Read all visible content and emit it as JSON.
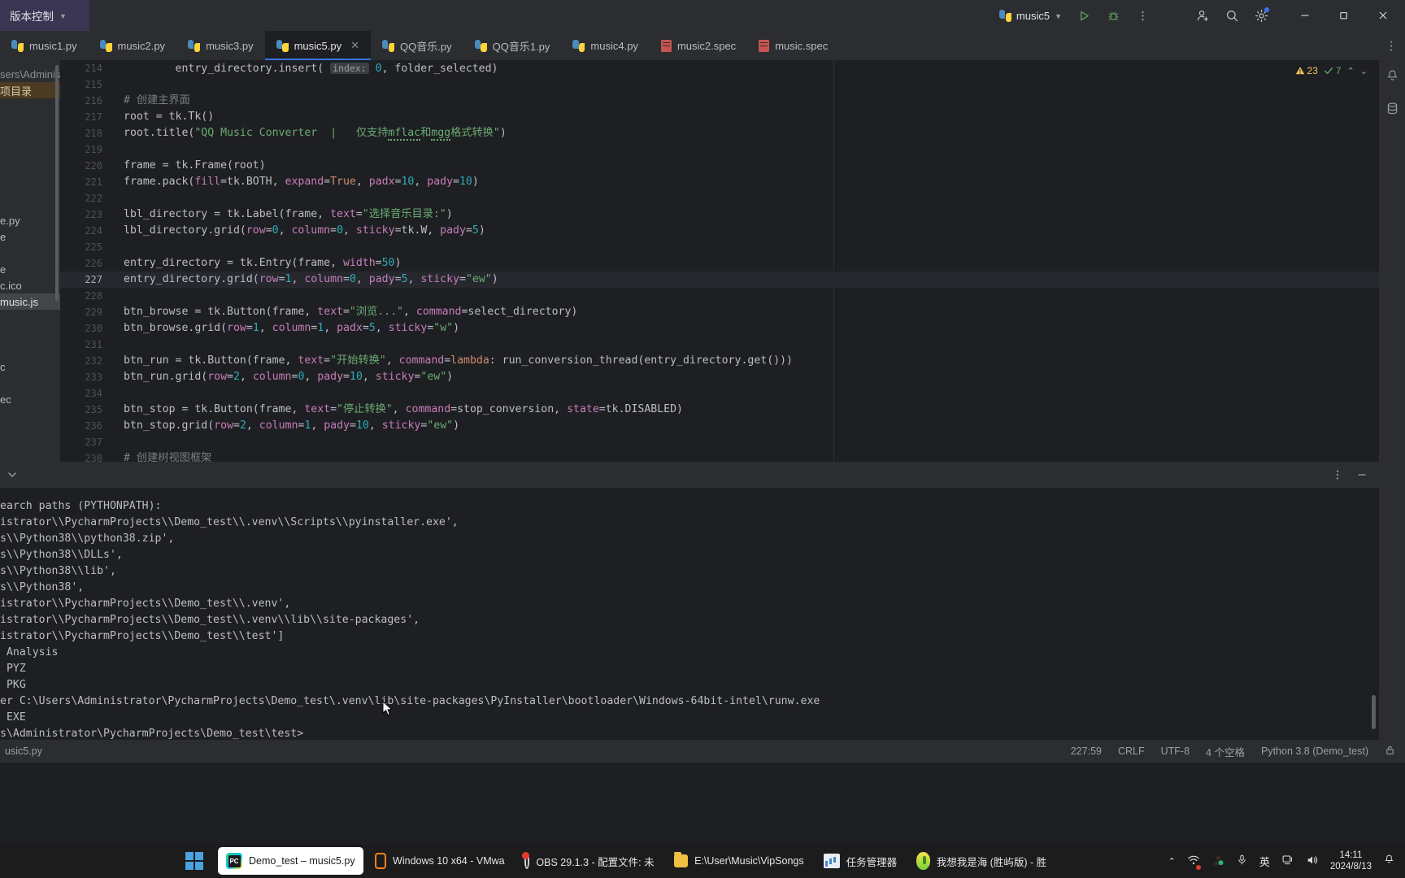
{
  "titlebar": {
    "vcs_label": "版本控制",
    "run_config": "music5",
    "icons": {
      "run": "run-icon",
      "debug": "debug-icon",
      "more": "more-options-icon",
      "add_user": "add-user-icon",
      "search": "search-icon",
      "settings": "settings-icon",
      "minimize": "minimize-icon",
      "maximize": "restore-icon",
      "close": "close-icon"
    }
  },
  "tabs": [
    {
      "label": "music1.py",
      "icon": "python-file-icon",
      "active": false,
      "closable": false
    },
    {
      "label": "music2.py",
      "icon": "python-file-icon",
      "active": false,
      "closable": false
    },
    {
      "label": "music3.py",
      "icon": "python-file-icon",
      "active": false,
      "closable": false
    },
    {
      "label": "music5.py",
      "icon": "python-file-icon",
      "active": true,
      "closable": true
    },
    {
      "label": "QQ音乐.py",
      "icon": "python-file-icon",
      "active": false,
      "closable": false
    },
    {
      "label": "QQ音乐1.py",
      "icon": "python-file-icon",
      "active": false,
      "closable": false
    },
    {
      "label": "music4.py",
      "icon": "python-file-icon",
      "active": false,
      "closable": false
    },
    {
      "label": "music2.spec",
      "icon": "spec-file-icon",
      "active": false,
      "closable": false
    },
    {
      "label": "music.spec",
      "icon": "spec-file-icon",
      "active": false,
      "closable": false
    }
  ],
  "project_panel": {
    "rows": [
      {
        "text": "sers\\Administrat",
        "style": "dimmed"
      },
      {
        "text": "项目录",
        "style": "sel-orange"
      },
      {
        "text": "",
        "style": "normal"
      },
      {
        "text": "",
        "style": "normal"
      },
      {
        "text": "",
        "style": "normal"
      },
      {
        "text": "",
        "style": "normal"
      },
      {
        "text": "",
        "style": "normal"
      },
      {
        "text": "",
        "style": "normal"
      },
      {
        "text": "",
        "style": "normal"
      },
      {
        "text": "e.py",
        "style": "normal"
      },
      {
        "text": "e",
        "style": "normal"
      },
      {
        "text": "",
        "style": "normal"
      },
      {
        "text": "e",
        "style": "normal"
      },
      {
        "text": "c.ico",
        "style": "normal"
      },
      {
        "text": "music.js",
        "style": "sel-grey"
      },
      {
        "text": "",
        "style": "normal"
      },
      {
        "text": "",
        "style": "normal"
      },
      {
        "text": "",
        "style": "normal"
      },
      {
        "text": "c",
        "style": "normal"
      },
      {
        "text": "",
        "style": "normal"
      },
      {
        "text": "ec",
        "style": "normal"
      }
    ]
  },
  "editor": {
    "inspections": {
      "warnings": "23",
      "ok": "7"
    },
    "first_line": 214,
    "current_line": 227,
    "lines": [
      {
        "n": 214,
        "html": "        <span class=\"fn\">entry_directory</span>.insert( <span class=\"hint\">index:</span> <span class=\"num\">0</span>, folder_selected)"
      },
      {
        "n": 215,
        "html": ""
      },
      {
        "n": 216,
        "html": "<span class=\"cmt\"># 创建主界面</span>"
      },
      {
        "n": 217,
        "html": "root = tk.Tk()"
      },
      {
        "n": 218,
        "html": "root.title(<span class=\"str\">\"QQ Music Converter  |   仅支持<span class=\"wavy\">mflac</span>和<span class=\"wavy\">mgg</span>格式转换\"</span>)"
      },
      {
        "n": 219,
        "html": ""
      },
      {
        "n": 220,
        "html": "frame = tk.Frame(root)"
      },
      {
        "n": 221,
        "html": "frame.pack(<span class=\"pname\">fill</span>=tk.BOTH, <span class=\"pname\">expand</span>=<span class=\"kw\">True</span>, <span class=\"pname\">padx</span>=<span class=\"num\">10</span>, <span class=\"pname\">pady</span>=<span class=\"num\">10</span>)"
      },
      {
        "n": 222,
        "html": ""
      },
      {
        "n": 223,
        "html": "lbl_directory = tk.Label(frame, <span class=\"pname\">text</span>=<span class=\"str\">\"选择音乐目录:\"</span>)"
      },
      {
        "n": 224,
        "html": "lbl_directory.grid(<span class=\"pname\">row</span>=<span class=\"num\">0</span>, <span class=\"pname\">column</span>=<span class=\"num\">0</span>, <span class=\"pname\">sticky</span>=tk.W, <span class=\"pname\">pady</span>=<span class=\"num\">5</span>)"
      },
      {
        "n": 225,
        "html": ""
      },
      {
        "n": 226,
        "html": "entry_directory = tk.Entry(frame, <span class=\"pname\">width</span>=<span class=\"num\">50</span>)"
      },
      {
        "n": 227,
        "html": "entry_directory.grid(<span class=\"pname\">row</span>=<span class=\"num\">1</span>, <span class=\"pname\">column</span>=<span class=\"num\">0</span>, <span class=\"pname\">pady</span>=<span class=\"num\">5</span>, <span class=\"pname\">sticky</span>=<span class=\"str\">\"ew\"</span>)"
      },
      {
        "n": 228,
        "html": ""
      },
      {
        "n": 229,
        "html": "btn_browse = tk.Button(frame, <span class=\"pname\">text</span>=<span class=\"str\">\"浏览...\"</span>, <span class=\"pname\">command</span>=select_directory)"
      },
      {
        "n": 230,
        "html": "btn_browse.grid(<span class=\"pname\">row</span>=<span class=\"num\">1</span>, <span class=\"pname\">column</span>=<span class=\"num\">1</span>, <span class=\"pname\">padx</span>=<span class=\"num\">5</span>, <span class=\"pname\">sticky</span>=<span class=\"str\">\"w\"</span>)"
      },
      {
        "n": 231,
        "html": ""
      },
      {
        "n": 232,
        "html": "btn_run = tk.Button(frame, <span class=\"pname\">text</span>=<span class=\"str\">\"开始转换\"</span>, <span class=\"pname\">command</span>=<span class=\"kw\">lambda</span>: run_conversion_thread(entry_directory.get()))"
      },
      {
        "n": 233,
        "html": "btn_run.grid(<span class=\"pname\">row</span>=<span class=\"num\">2</span>, <span class=\"pname\">column</span>=<span class=\"num\">0</span>, <span class=\"pname\">pady</span>=<span class=\"num\">10</span>, <span class=\"pname\">sticky</span>=<span class=\"str\">\"ew\"</span>)"
      },
      {
        "n": 234,
        "html": ""
      },
      {
        "n": 235,
        "html": "btn_stop = tk.Button(frame, <span class=\"pname\">text</span>=<span class=\"str\">\"停止转换\"</span>, <span class=\"pname\">command</span>=stop_conversion, <span class=\"pname\">state</span>=tk.DISABLED)"
      },
      {
        "n": 236,
        "html": "btn_stop.grid(<span class=\"pname\">row</span>=<span class=\"num\">2</span>, <span class=\"pname\">column</span>=<span class=\"num\">1</span>, <span class=\"pname\">pady</span>=<span class=\"num\">10</span>, <span class=\"pname\">sticky</span>=<span class=\"str\">\"ew\"</span>)"
      },
      {
        "n": 237,
        "html": ""
      },
      {
        "n": 238,
        "html": "<span class=\"cmt\"># 创建树视图框架</span>"
      }
    ]
  },
  "console": {
    "lines": [
      "earch paths (PYTHONPATH):",
      "istrator\\\\PycharmProjects\\\\Demo_test\\\\.venv\\\\Scripts\\\\pyinstaller.exe',",
      "s\\\\Python38\\\\python38.zip',",
      "s\\\\Python38\\\\DLLs',",
      "s\\\\Python38\\\\lib',",
      "s\\\\Python38',",
      "istrator\\\\PycharmProjects\\\\Demo_test\\\\.venv',",
      "istrator\\\\PycharmProjects\\\\Demo_test\\\\.venv\\\\lib\\\\site-packages',",
      "istrator\\\\PycharmProjects\\\\Demo_test\\\\test']",
      " Analysis",
      " PYZ",
      " PKG",
      "er C:\\Users\\Administrator\\PycharmProjects\\Demo_test\\.venv\\lib\\site-packages\\PyInstaller\\bootloader\\Windows-64bit-intel\\runw.exe",
      " EXE",
      "s\\Administrator\\PycharmProjects\\Demo_test\\test>"
    ]
  },
  "statusbar": {
    "file_label": "usic5.py",
    "caret": "227:59",
    "line_sep": "CRLF",
    "encoding": "UTF-8",
    "indent": "4 个空格",
    "interpreter": "Python 3.8 (Demo_test)",
    "lock_icon": "lock-icon"
  },
  "taskbar": {
    "items": [
      {
        "label": "Demo_test – music5.py",
        "icon": "pycharm-icon",
        "active": true
      },
      {
        "label": "Windows 10 x64 - VMwa",
        "icon": "vmware-icon",
        "active": false
      },
      {
        "label": "OBS 29.1.3 - 配置文件: 未",
        "icon": "obs-icon",
        "active": false
      },
      {
        "label": "E:\\User\\Music\\VipSongs",
        "icon": "folder-icon",
        "active": false
      },
      {
        "label": "任务管理器",
        "icon": "task-manager-icon",
        "active": false
      },
      {
        "label": "我想我是海 (胜屿版) - 胜",
        "icon": "music-player-icon",
        "active": false
      }
    ],
    "tray": {
      "overflow_icon": "chevron-up-icon",
      "network_icon": "network-icon",
      "security_icon": "security-icon",
      "mic_icon": "microphone-icon",
      "ime_label": "英",
      "display_icon": "display-icon",
      "volume_icon": "volume-icon",
      "time": "14:11",
      "date": "2024/8/13",
      "notification_icon": "bell-icon"
    }
  }
}
